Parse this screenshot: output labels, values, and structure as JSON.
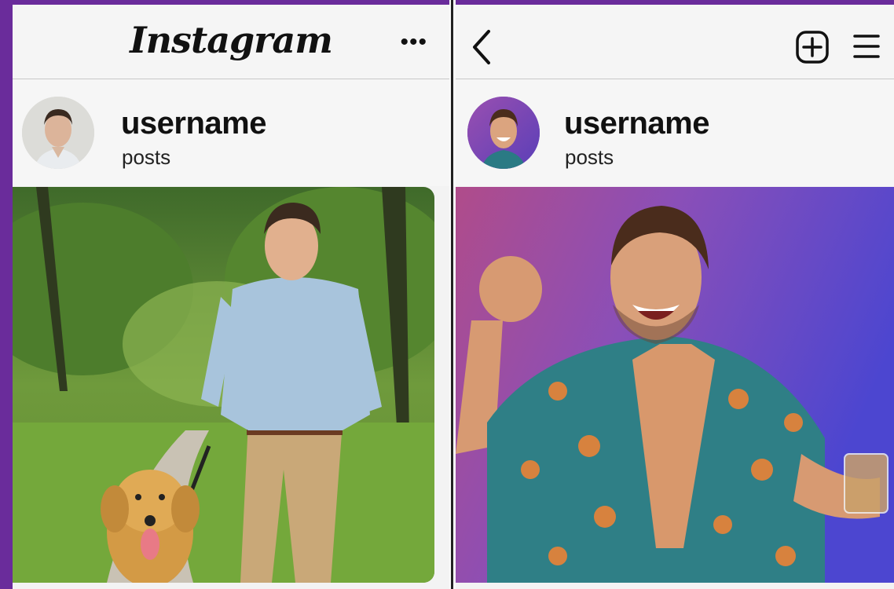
{
  "left_panel": {
    "header": {
      "logo_text": "Instagram",
      "more_icon": "more-horizontal-icon"
    },
    "profile": {
      "username": "username",
      "subtitle": "posts"
    },
    "post": {
      "description_icon": "photo-man-walking-dog"
    }
  },
  "right_panel": {
    "header": {
      "back_icon": "chevron-left-icon",
      "add_icon": "plus-square-icon",
      "menu_icon": "hamburger-menu-icon"
    },
    "profile": {
      "username": "username",
      "subtitle": "posts"
    },
    "post": {
      "description_icon": "photo-man-celebrating"
    }
  },
  "colors": {
    "frame": "#6a2c9b",
    "panel_bg": "#f3f3f3",
    "text": "#111111"
  }
}
